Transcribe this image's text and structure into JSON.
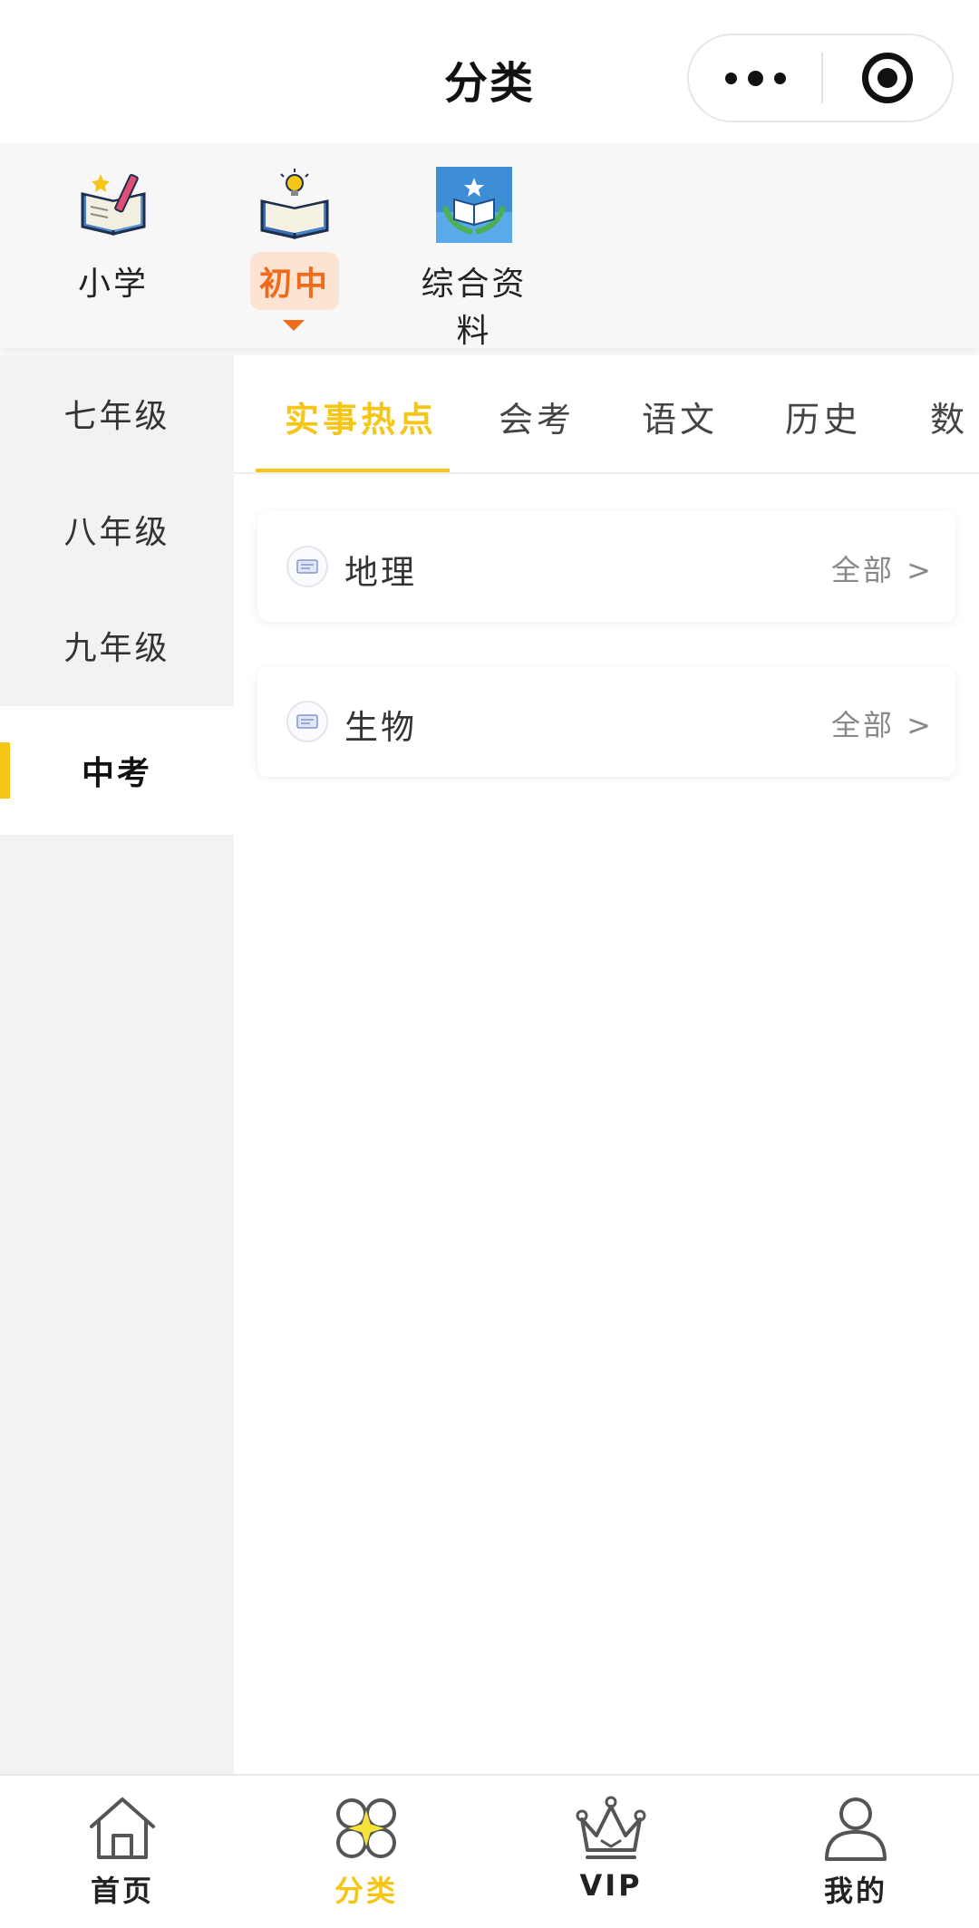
{
  "header": {
    "title": "分类",
    "more_icon": "more-dots-icon",
    "close_icon": "target-circle-icon"
  },
  "levels": [
    {
      "label": "小学",
      "icon": "book-pencil-icon",
      "active": false
    },
    {
      "label": "初中",
      "icon": "book-bulb-icon",
      "active": true
    },
    {
      "label": "综合资料",
      "icon": "book-star-emblem-icon",
      "active": false
    }
  ],
  "grades": [
    {
      "label": "七年级",
      "active": false
    },
    {
      "label": "八年级",
      "active": false
    },
    {
      "label": "九年级",
      "active": false
    },
    {
      "label": "中考",
      "active": true
    }
  ],
  "tabs": [
    {
      "label": "实事热点",
      "active": true
    },
    {
      "label": "会考",
      "active": false
    },
    {
      "label": "语文",
      "active": false
    },
    {
      "label": "历史",
      "active": false
    },
    {
      "label": "数",
      "active": false
    }
  ],
  "categories": [
    {
      "title": "地理",
      "more": "全部 >",
      "icon": "subject-icon"
    },
    {
      "title": "生物",
      "more": "全部 >",
      "icon": "subject-icon"
    }
  ],
  "bottom_nav": [
    {
      "label": "首页",
      "icon": "home-icon",
      "active": false
    },
    {
      "label": "分类",
      "icon": "category-icon",
      "active": true
    },
    {
      "label": "VIP",
      "icon": "crown-icon",
      "active": false
    },
    {
      "label": "我的",
      "icon": "user-icon",
      "active": false
    }
  ],
  "colors": {
    "accent": "#f5c518",
    "level_active": "#f06a1c",
    "level_active_bg": "#fde3d2",
    "sidebar_bg": "#f2f2f2"
  }
}
